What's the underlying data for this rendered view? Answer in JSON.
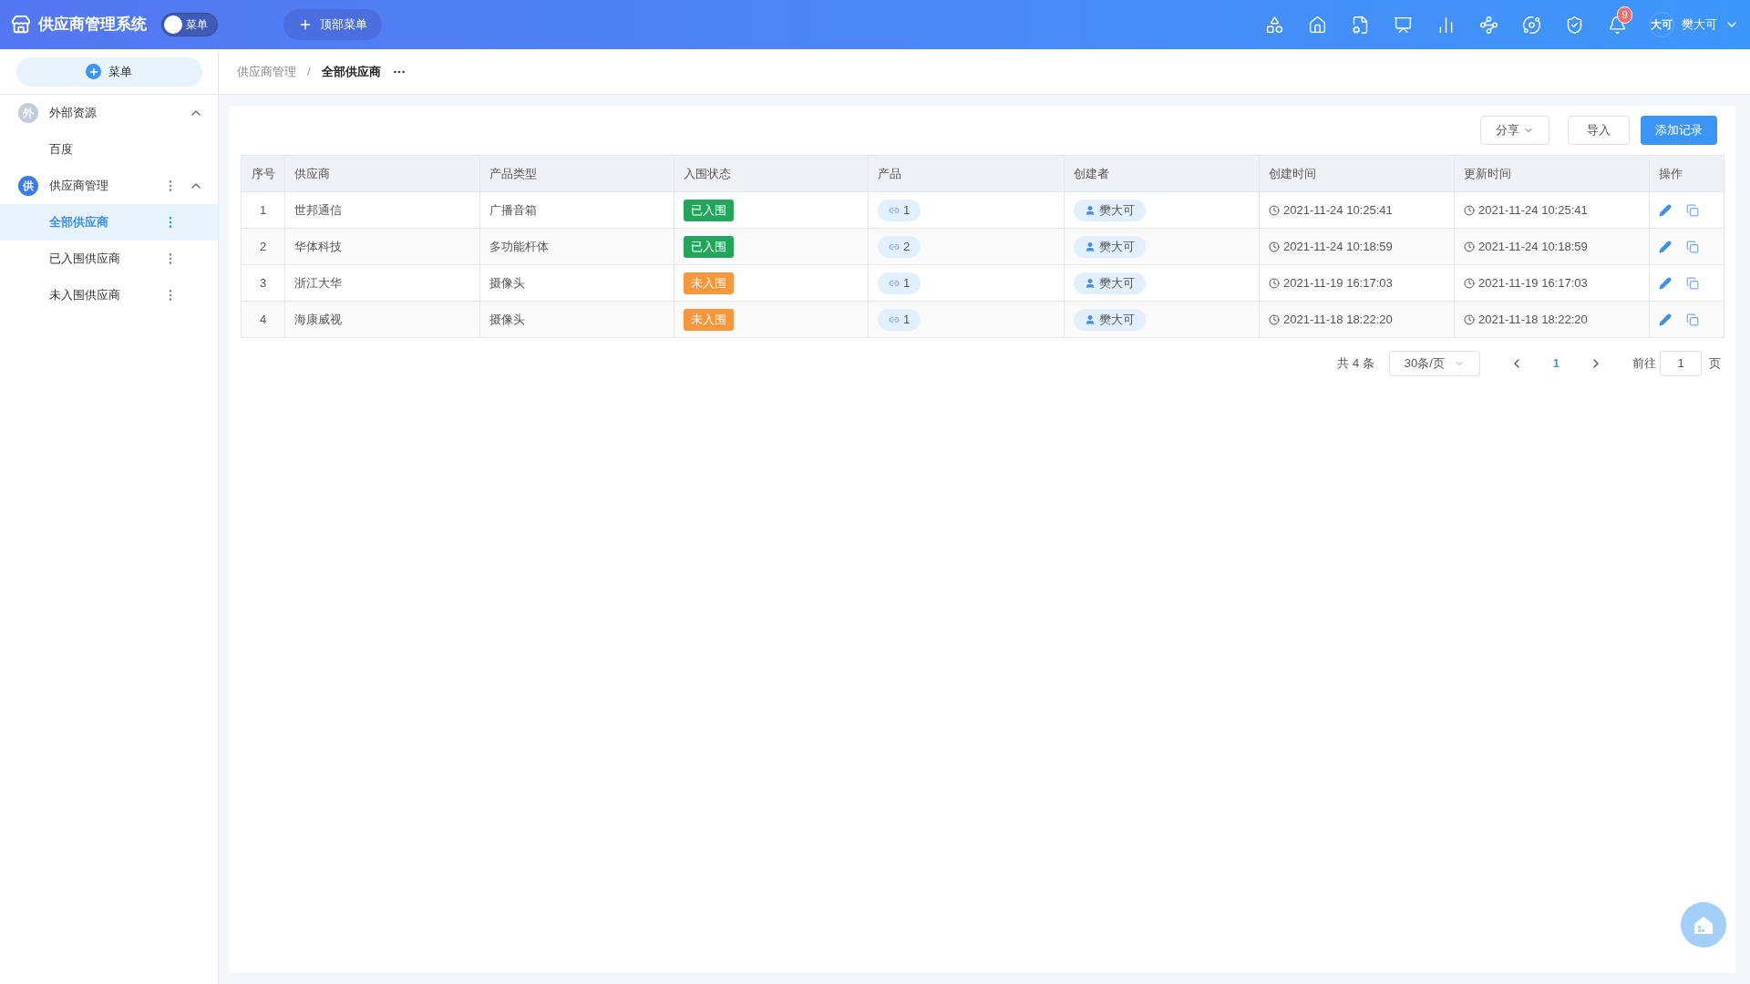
{
  "header": {
    "app_title": "供应商管理系统",
    "menu_switch": {
      "label": "菜单",
      "on": false
    },
    "top_menu_button": "顶部菜单",
    "notification_count": "9",
    "user": {
      "avatar_text": "大可",
      "name": "樊大可"
    }
  },
  "sidebar": {
    "add_menu_button": "菜单",
    "groups": [
      {
        "badge": "外",
        "label": "外部资源",
        "expanded": true,
        "has_more": false,
        "active": false,
        "children": [
          {
            "label": "百度",
            "selected": false,
            "has_more": false
          }
        ]
      },
      {
        "badge": "供",
        "label": "供应商管理",
        "expanded": true,
        "has_more": true,
        "active": true,
        "children": [
          {
            "label": "全部供应商",
            "selected": true,
            "has_more": true
          },
          {
            "label": "已入围供应商",
            "selected": false,
            "has_more": true
          },
          {
            "label": "未入围供应商",
            "selected": false,
            "has_more": true
          }
        ]
      }
    ]
  },
  "breadcrumb": [
    "供应商管理",
    "全部供应商"
  ],
  "breadcrumb_separator": "/",
  "toolbar": {
    "share_button": "分享",
    "import_button": "导入",
    "add_button": "添加记录"
  },
  "table": {
    "columns": [
      "序号",
      "供应商",
      "产品类型",
      "入围状态",
      "产品",
      "创建者",
      "创建时间",
      "更新时间",
      "操作"
    ],
    "rows": [
      {
        "index": "1",
        "supplier": "世邦通信",
        "product_type": "广播音箱",
        "status": {
          "text": "已入围",
          "color": "#21a65c"
        },
        "products": "1",
        "creator": "樊大可",
        "created": "2021-11-24 10:25:41",
        "updated": "2021-11-24 10:25:41"
      },
      {
        "index": "2",
        "supplier": "华体科技",
        "product_type": "多功能杆体",
        "status": {
          "text": "已入围",
          "color": "#21a65c"
        },
        "products": "2",
        "creator": "樊大可",
        "created": "2021-11-24 10:18:59",
        "updated": "2021-11-24 10:18:59"
      },
      {
        "index": "3",
        "supplier": "浙江大华",
        "product_type": "摄像头",
        "status": {
          "text": "未入围",
          "color": "#f7963a"
        },
        "products": "1",
        "creator": "樊大可",
        "created": "2021-11-19 16:17:03",
        "updated": "2021-11-19 16:17:03"
      },
      {
        "index": "4",
        "supplier": "海康威视",
        "product_type": "摄像头",
        "status": {
          "text": "未入围",
          "color": "#f7963a"
        },
        "products": "1",
        "creator": "樊大可",
        "created": "2021-11-18 18:22:20",
        "updated": "2021-11-18 18:22:20"
      }
    ]
  },
  "pagination": {
    "total": "共 4 条",
    "page_size": "30条/页",
    "current_page": "1",
    "goto_label": "前往",
    "goto_value": "1",
    "page_unit": "页"
  }
}
